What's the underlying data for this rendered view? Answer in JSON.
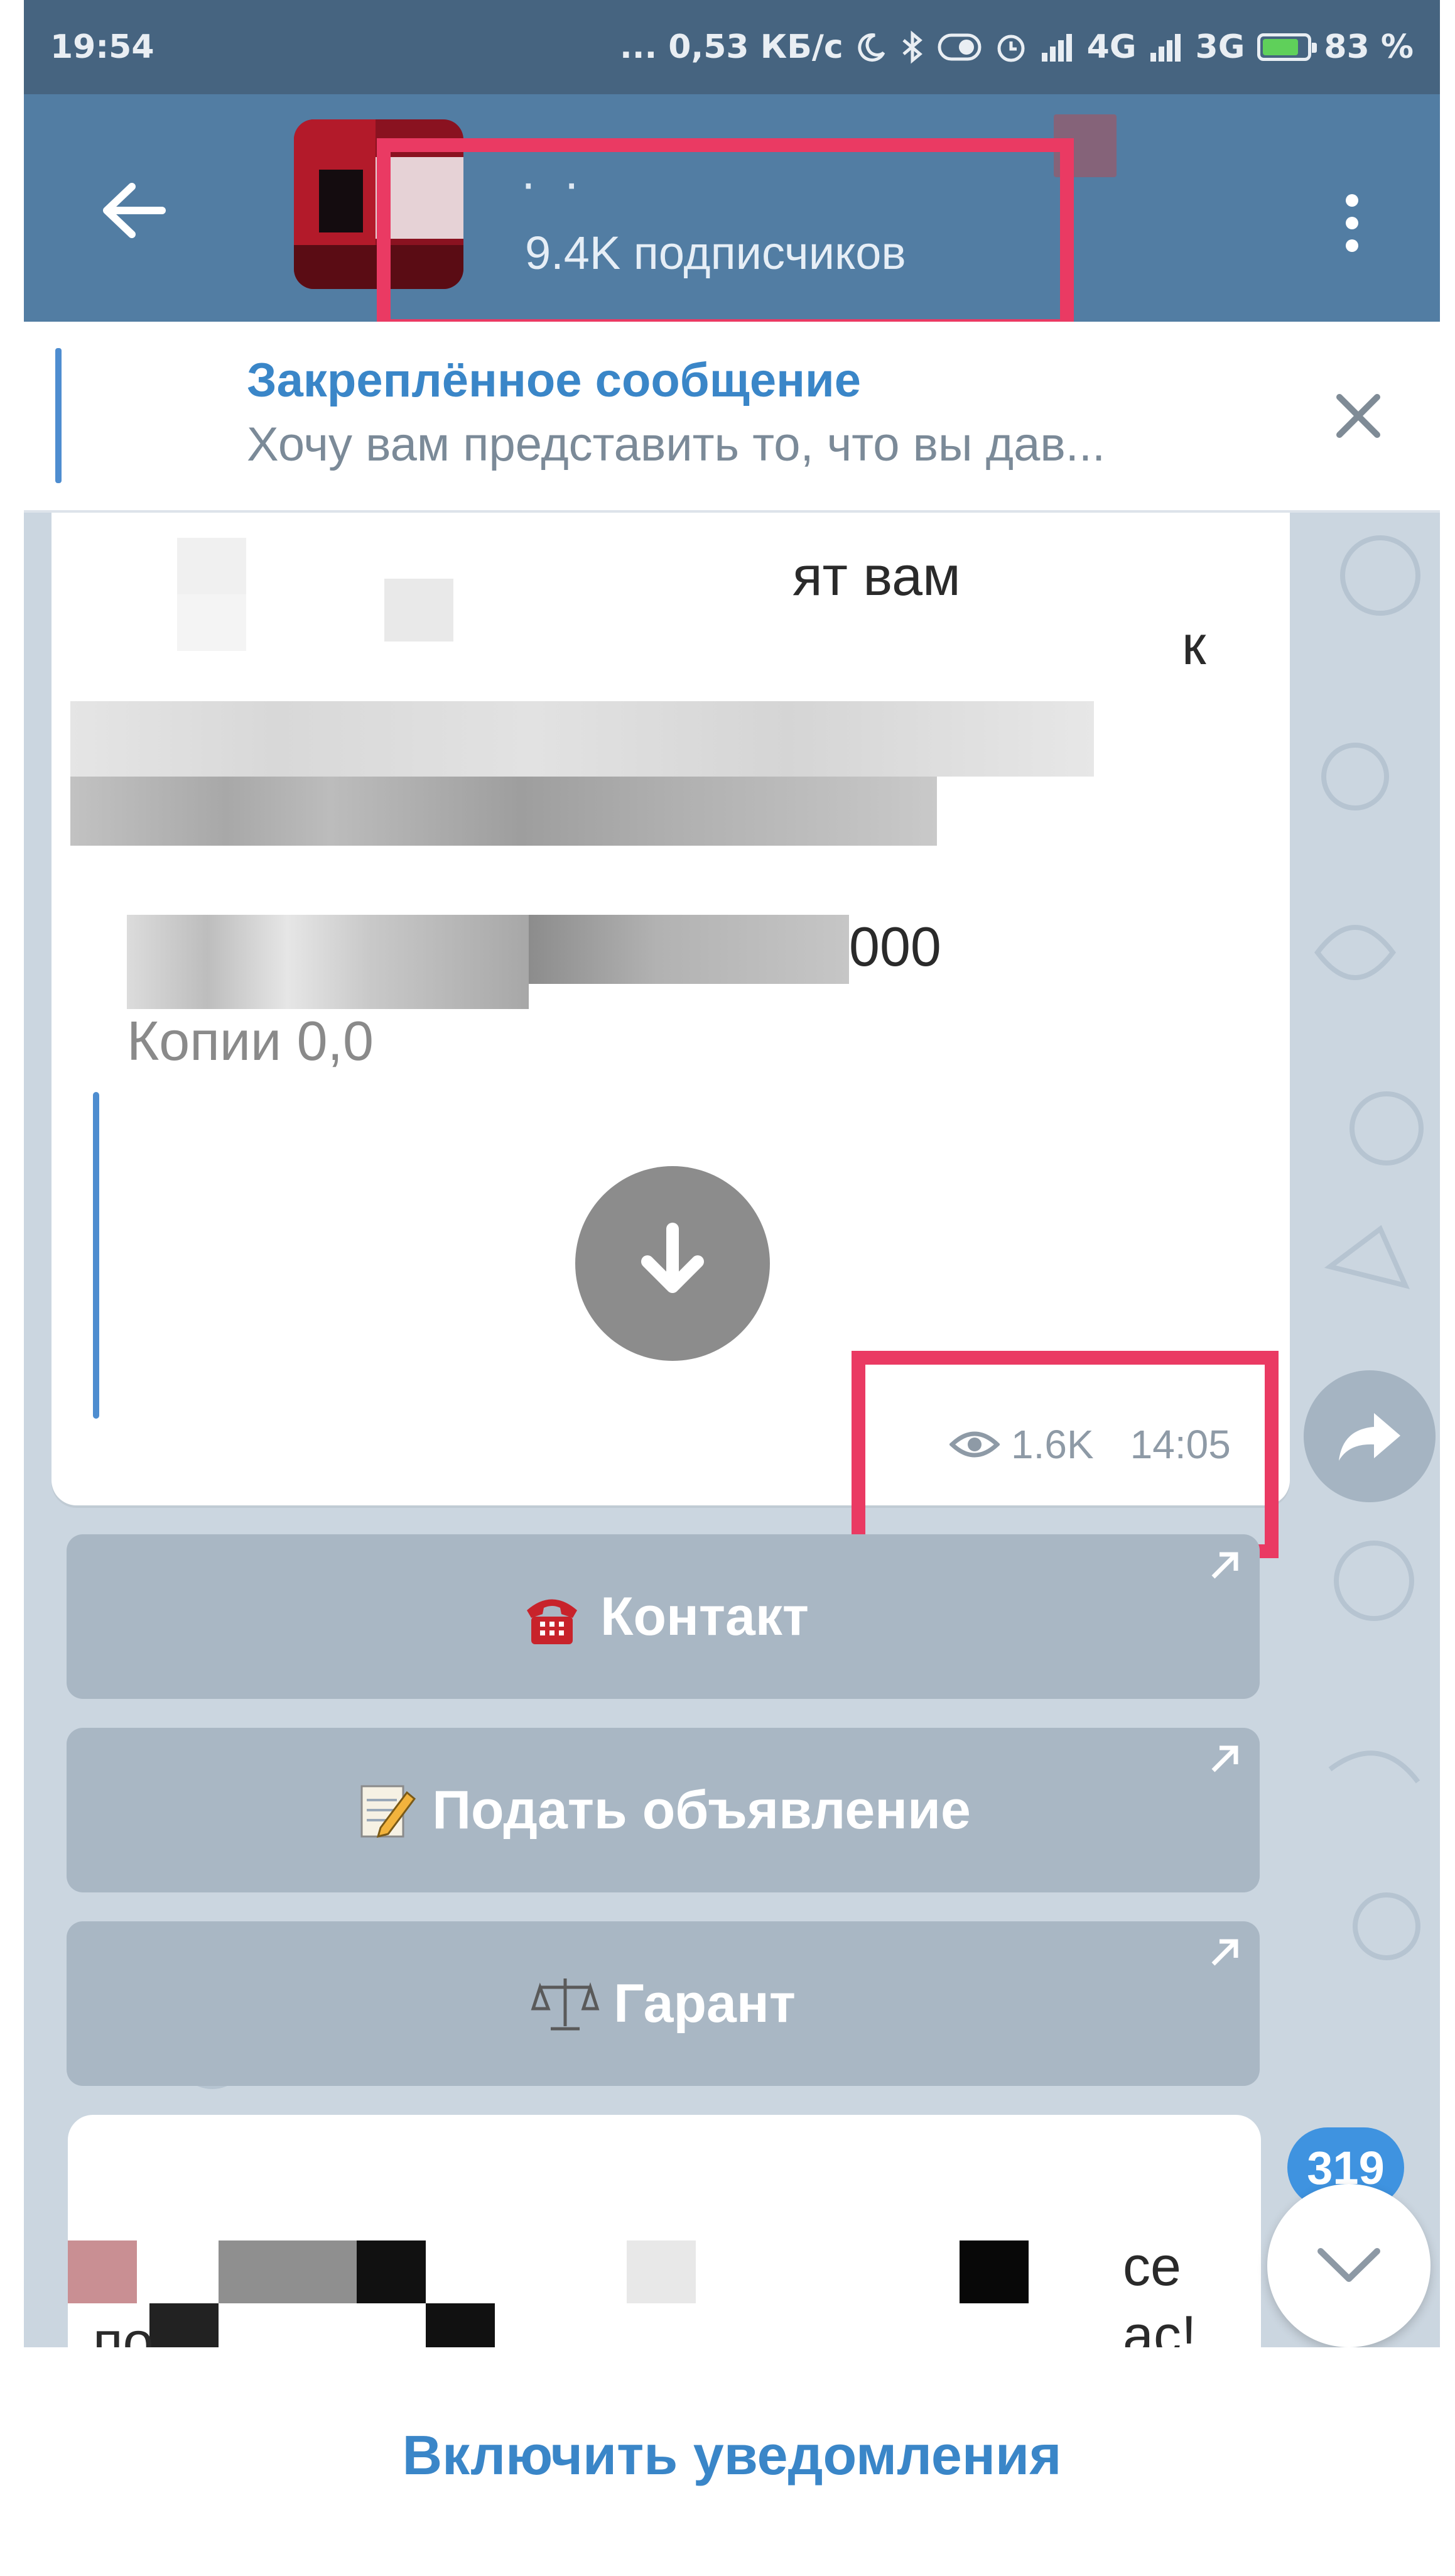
{
  "status_bar": {
    "time": "19:54",
    "network_speed": "... 0,53 КБ/с",
    "signal_1": "4G",
    "signal_2": "3G",
    "battery_percent": "83 %",
    "battery_level": 0.83,
    "icons": [
      "moon-icon",
      "bluetooth-icon",
      "toggle-icon",
      "alarm-icon",
      "signal-icon",
      "battery-icon"
    ]
  },
  "app_bar": {
    "channel_title": "·  ·",
    "subscribers": "9.4K подписчиков",
    "highlight_color": "#ea3a63"
  },
  "pinned": {
    "title": "Закреплённое сообщение",
    "text": "Хочу вам представить то, что вы дав..."
  },
  "message": {
    "fragments": [
      "ят вам",
      "к",
      "000",
      "Копии 0,0"
    ],
    "views": "1.6K",
    "time": "14:05"
  },
  "inline_buttons": [
    {
      "label": "Контакт",
      "emoji": "telephone"
    },
    {
      "label": "Подать объявление",
      "emoji": "memo"
    },
    {
      "label": "Гарант",
      "emoji": "scales"
    }
  ],
  "message2": {
    "fragments": [
      "се",
      "по",
      "ас!"
    ]
  },
  "unread_count": "319",
  "bottom_action": "Включить уведомления",
  "colors": {
    "header": "#527da3",
    "statusbar": "#466480",
    "accent": "#3a86c8",
    "chat_bg": "#cbd6e0"
  }
}
